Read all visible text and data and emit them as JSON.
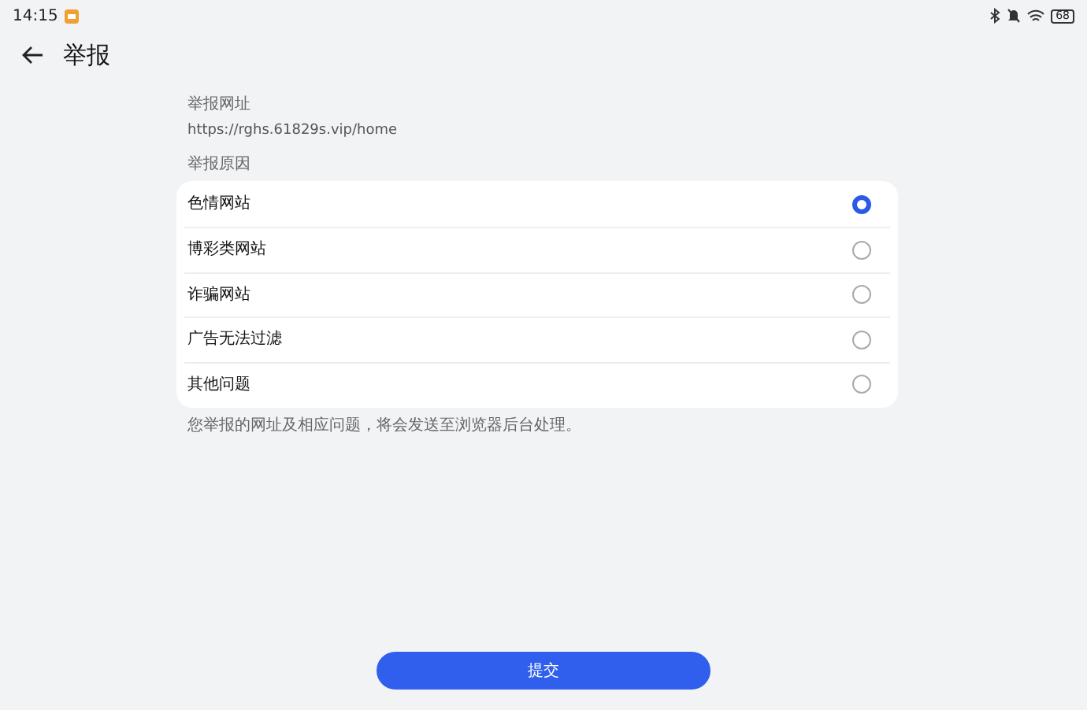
{
  "status_bar": {
    "time": "14:15",
    "battery": "68"
  },
  "header": {
    "title": "举报"
  },
  "url_section": {
    "label": "举报网址",
    "value": "https://rghs.61829s.vip/home"
  },
  "reason_section": {
    "label": "举报原因",
    "options": [
      {
        "label": "色情网站",
        "selected": true
      },
      {
        "label": "博彩类网站",
        "selected": false
      },
      {
        "label": "诈骗网站",
        "selected": false
      },
      {
        "label": "广告无法过滤",
        "selected": false
      },
      {
        "label": "其他问题",
        "selected": false
      }
    ]
  },
  "note": "您举报的网址及相应问题，将会发送至浏览器后台处理。",
  "submit_button": "提交"
}
